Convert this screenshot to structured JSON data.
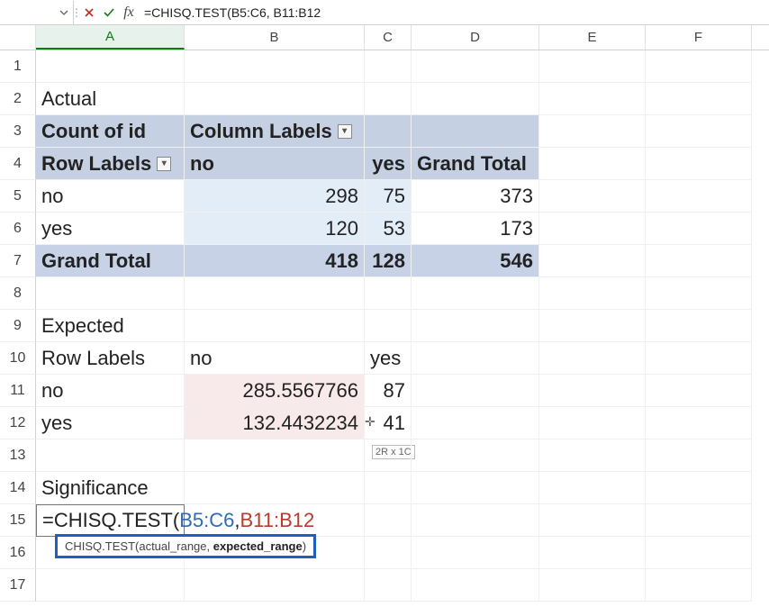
{
  "formula_bar": {
    "name_box": "",
    "formula": "=CHISQ.TEST(B5:C6, B11:B12"
  },
  "columns": [
    "A",
    "B",
    "C",
    "D",
    "E",
    "F"
  ],
  "rows": [
    "1",
    "2",
    "3",
    "4",
    "5",
    "6",
    "7",
    "8",
    "9",
    "10",
    "11",
    "12",
    "13",
    "14",
    "15",
    "16",
    "17"
  ],
  "labels": {
    "actual": "Actual",
    "count_of_id": "Count of id",
    "column_labels": "Column Labels",
    "row_labels": "Row Labels",
    "grand_total": "Grand Total",
    "expected": "Expected",
    "significance": "Significance"
  },
  "pivot": {
    "col_no": "no",
    "col_yes": "yes",
    "rows": [
      {
        "label": "no",
        "no": "298",
        "yes": "75",
        "total": "373"
      },
      {
        "label": "yes",
        "no": "120",
        "yes": "53",
        "total": "173"
      }
    ],
    "totals": {
      "no": "418",
      "yes": "128",
      "total": "546"
    }
  },
  "expected": {
    "col_no": "no",
    "col_yes": "yes",
    "rows": [
      {
        "label": "no",
        "no": "285.5567766",
        "yes": "87"
      },
      {
        "label": "yes",
        "no": "132.4432234",
        "yes": "41"
      }
    ]
  },
  "formula_edit": {
    "fn": "=CHISQ.TEST(",
    "r1": "B5:C6",
    "sep": ", ",
    "r2": "B11:B12"
  },
  "tooltip": {
    "pre": "CHISQ.TEST(actual_range, ",
    "bold": "expected_range",
    "post": ")"
  },
  "size_indicator": "2R x 1C"
}
